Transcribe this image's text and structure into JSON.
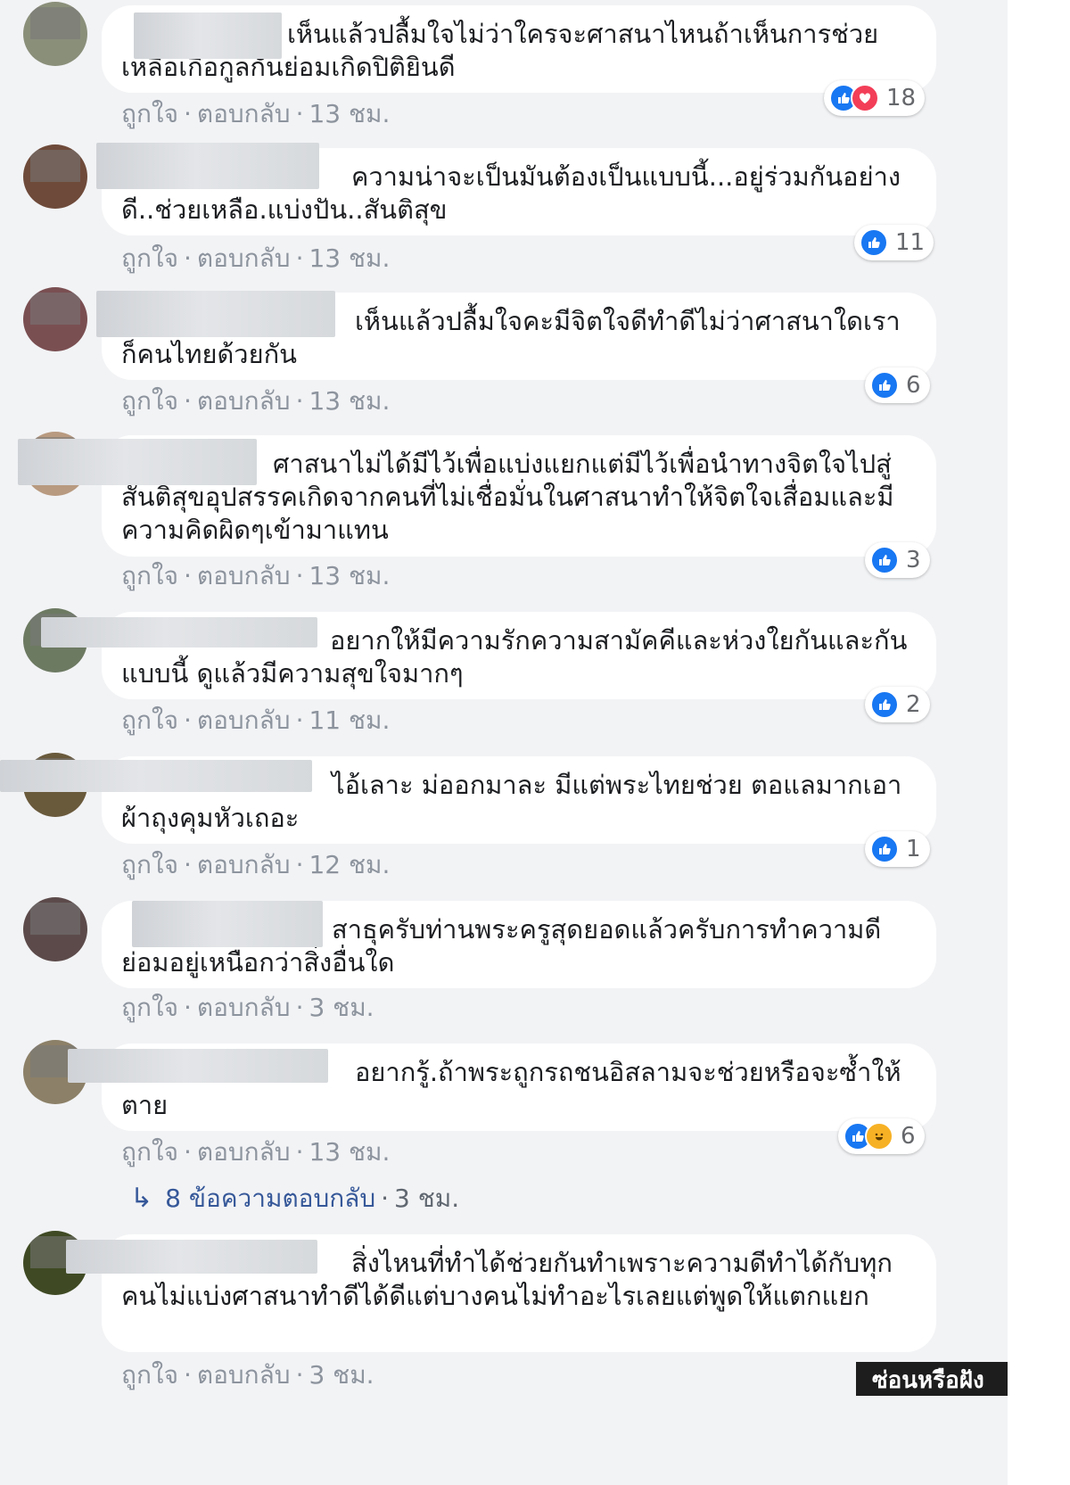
{
  "actions": {
    "like": "ถูกใจ",
    "reply": "ตอบกลับ",
    "sep": "·"
  },
  "comments": [
    {
      "text": "เห็นแล้วปลื้มใจไม่ว่าใครจะศาสนาไหนถ้าเห็นการช่วยเหลือเกื้อกูลกันย่อมเกิดปิติยินดี",
      "time": "13 ชม.",
      "reaction_count": "18",
      "reactions": [
        "like",
        "love"
      ]
    },
    {
      "text": "ความน่าจะเป็นมันต้องเป็นแบบนี้...อยู่ร่วมกันอย่างดี..ช่วยเหลือ.แบ่งปัน..สันติสุข",
      "time": "13 ชม.",
      "reaction_count": "11",
      "reactions": [
        "like"
      ]
    },
    {
      "text": "เห็นแล้วปลื้มใจคะมีจิตใจดีทำดีไม่ว่าศาสนาใดเราก็คนไทยด้วยกัน",
      "time": "13 ชม.",
      "reaction_count": "6",
      "reactions": [
        "like"
      ]
    },
    {
      "text": "ศาสนาไม่ได้มีไว้เพื่อแบ่งแยกแต่มีไว้เพื่อนำทางจิตใจไปสู่สันติสุขอุปสรรคเกิดจากคนที่ไม่เชื่อมั่นในศาสนาทำให้จิตใจเสื่อมและมีความคิดผิดๆเข้ามาแทน",
      "time": "13 ชม.",
      "reaction_count": "3",
      "reactions": [
        "like"
      ]
    },
    {
      "text": "อยากให้มีความรักความสามัคคีและห่วงใยกันและกันแบบนี้ ดูแล้วมีความสุขใจมากๆ",
      "time": "11 ชม.",
      "reaction_count": "2",
      "reactions": [
        "like"
      ]
    },
    {
      "text": "ไอ้เลาะ ม่ออกมาละ มีแต่พระไทยช่วย ตอแลมากเอาผ้าถุงคุมหัวเถอะ",
      "time": "12 ชม.",
      "reaction_count": "1",
      "reactions": [
        "like"
      ]
    },
    {
      "text": "สาธุครับท่านพระครูสุดยอดแล้วครับการทำความดีย่อมอยู่เหนือกว่าสิ่งอื่นใด",
      "time": "3 ชม.",
      "reaction_count": "",
      "reactions": []
    },
    {
      "text": "อยากรู้.ถ้าพระถูกรถชนอิสลามจะช่วยหรือจะซ้ำให้ตาย",
      "time": "13 ชม.",
      "reaction_count": "6",
      "reactions": [
        "like",
        "haha"
      ]
    },
    {
      "text": "สิ่งไหนที่ทำได้ช่วยกันทำเพราะความดีทำได้กับทุกคนไม่แบ่งศาสนาทำดีได้ดีแต่บางคนไม่ทำอะไรเลยแต่พูดให้แตกแยก",
      "time": "3 ชม.",
      "reaction_count": "",
      "reactions": []
    }
  ],
  "replies": {
    "label": "8 ข้อความตอบกลับ",
    "time": "3 ชม."
  },
  "corner": {
    "label": "ซ่อนหรือฝัง"
  },
  "colors": {
    "background": "#f2f3f5",
    "bubble": "#ffffff",
    "text": "#1c1e21",
    "meta": "#8d949e",
    "link": "#365899",
    "like": "#1877f2",
    "love": "#f33e58",
    "haha": "#f7b125"
  }
}
